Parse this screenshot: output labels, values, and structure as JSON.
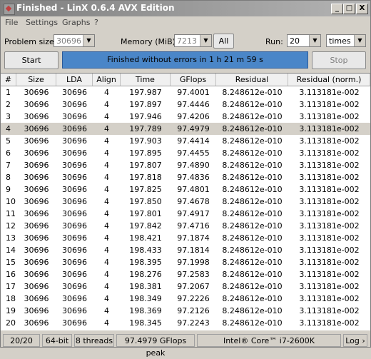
{
  "window": {
    "title": "Finished - LinX 0.6.4 AVX Edition",
    "min": "_",
    "max": "□",
    "close": "X"
  },
  "menu": [
    "File",
    "Settings",
    "Graphs",
    "?"
  ],
  "controls": {
    "problem_size_label": "Problem size:",
    "problem_size_value": "30696",
    "memory_label": "Memory (MiB):",
    "memory_value": "7213",
    "all_button": "All",
    "run_label": "Run:",
    "run_value": "20",
    "run_unit": "times",
    "start_button": "Start",
    "stop_button": "Stop",
    "status": "Finished without errors in 1 h 21 m 59 s"
  },
  "table": {
    "headers": [
      "#",
      "Size",
      "LDA",
      "Align",
      "Time",
      "GFlops",
      "Residual",
      "Residual (norm.)"
    ],
    "selected_index": 3,
    "rows": [
      [
        "1",
        "30696",
        "30696",
        "4",
        "197.987",
        "97.4001",
        "8.248612e-010",
        "3.113181e-002"
      ],
      [
        "2",
        "30696",
        "30696",
        "4",
        "197.897",
        "97.4446",
        "8.248612e-010",
        "3.113181e-002"
      ],
      [
        "3",
        "30696",
        "30696",
        "4",
        "197.946",
        "97.4206",
        "8.248612e-010",
        "3.113181e-002"
      ],
      [
        "4",
        "30696",
        "30696",
        "4",
        "197.789",
        "97.4979",
        "8.248612e-010",
        "3.113181e-002"
      ],
      [
        "5",
        "30696",
        "30696",
        "4",
        "197.903",
        "97.4414",
        "8.248612e-010",
        "3.113181e-002"
      ],
      [
        "6",
        "30696",
        "30696",
        "4",
        "197.895",
        "97.4455",
        "8.248612e-010",
        "3.113181e-002"
      ],
      [
        "7",
        "30696",
        "30696",
        "4",
        "197.807",
        "97.4890",
        "8.248612e-010",
        "3.113181e-002"
      ],
      [
        "8",
        "30696",
        "30696",
        "4",
        "197.818",
        "97.4836",
        "8.248612e-010",
        "3.113181e-002"
      ],
      [
        "9",
        "30696",
        "30696",
        "4",
        "197.825",
        "97.4801",
        "8.248612e-010",
        "3.113181e-002"
      ],
      [
        "10",
        "30696",
        "30696",
        "4",
        "197.850",
        "97.4678",
        "8.248612e-010",
        "3.113181e-002"
      ],
      [
        "11",
        "30696",
        "30696",
        "4",
        "197.801",
        "97.4917",
        "8.248612e-010",
        "3.113181e-002"
      ],
      [
        "12",
        "30696",
        "30696",
        "4",
        "197.842",
        "97.4716",
        "8.248612e-010",
        "3.113181e-002"
      ],
      [
        "13",
        "30696",
        "30696",
        "4",
        "198.421",
        "97.1874",
        "8.248612e-010",
        "3.113181e-002"
      ],
      [
        "14",
        "30696",
        "30696",
        "4",
        "198.433",
        "97.1814",
        "8.248612e-010",
        "3.113181e-002"
      ],
      [
        "15",
        "30696",
        "30696",
        "4",
        "198.395",
        "97.1998",
        "8.248612e-010",
        "3.113181e-002"
      ],
      [
        "16",
        "30696",
        "30696",
        "4",
        "198.276",
        "97.2583",
        "8.248612e-010",
        "3.113181e-002"
      ],
      [
        "17",
        "30696",
        "30696",
        "4",
        "198.381",
        "97.2067",
        "8.248612e-010",
        "3.113181e-002"
      ],
      [
        "18",
        "30696",
        "30696",
        "4",
        "198.349",
        "97.2226",
        "8.248612e-010",
        "3.113181e-002"
      ],
      [
        "19",
        "30696",
        "30696",
        "4",
        "198.369",
        "97.2126",
        "8.248612e-010",
        "3.113181e-002"
      ],
      [
        "20",
        "30696",
        "30696",
        "4",
        "198.345",
        "97.2243",
        "8.248612e-010",
        "3.113181e-002"
      ]
    ]
  },
  "footer": {
    "progress": "20/20",
    "arch": "64-bit",
    "threads": "8 threads",
    "peak": "97.4979 GFlops peak",
    "cpu": "Intel® Core™ i7-2600K",
    "log": "Log ›"
  },
  "colors": {
    "accent_bar": "#4a86c8",
    "selected_row": "#d4d0c8"
  }
}
